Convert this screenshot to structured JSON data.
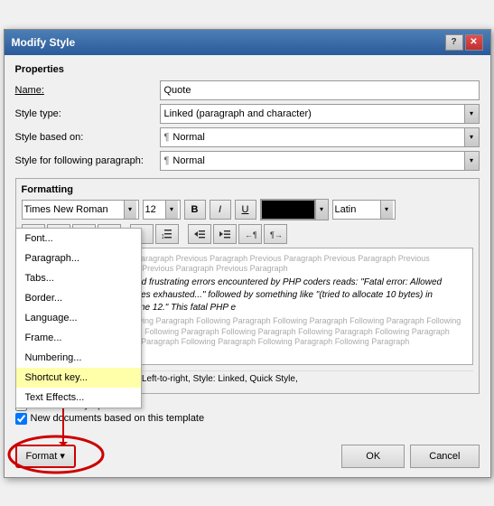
{
  "dialog": {
    "title": "Modify Style",
    "title_buttons": {
      "help": "?",
      "close": "✕"
    }
  },
  "properties": {
    "label": "Properties",
    "name_label": "Name:",
    "name_value": "Quote",
    "style_type_label": "Style type:",
    "style_type_value": "Linked (paragraph and character)",
    "style_based_label": "Style based on:",
    "style_based_value": "Normal",
    "style_following_label": "Style for following paragraph:",
    "style_following_value": "Normal"
  },
  "formatting": {
    "label": "Formatting",
    "font_name": "Times New Roman",
    "font_size": "12",
    "bold_label": "B",
    "italic_label": "I",
    "underline_label": "U",
    "lang_label": "Latin",
    "align_buttons": [
      "left-align",
      "center-align",
      "right-align",
      "justify-align",
      "left2",
      "center2",
      "right2"
    ],
    "indent_buttons": [
      "indent-left",
      "indent-right",
      "outdent",
      "more-indent"
    ]
  },
  "preview": {
    "prev_para": "Previous Paragraph Previous Paragraph Previous Paragraph Previous Paragraph Previous Paragraph Previous Paragraph Previous Paragraph Previous Paragraph Previous Paragraph",
    "main_text": "One of the most common and frustrating errors encountered by PHP coders reads: \"Fatal error: Allowed memory size of 8388608 bytes exhausted...\" followed by something like \"(tried to allocate 10 bytes) in /home/www/file.module on line 12.\" This fatal PHP e",
    "next_para": "rror Following Paragraph Following Paragraph Following Paragraph Following Paragraph Following Paragraph Following Paragraph Following Paragraph Following Paragraph Following Paragraph Following Paragraph Following Paragraph Following Paragraph Following Paragraph Following Paragraph Following Paragraph Following Paragraph"
  },
  "style_desc": "1, Complex Script Font: Italic, Left-to-right, Style: Linked, Quick Style,",
  "checkboxes": {
    "auto_update_label": "Automatically update",
    "new_docs_label": "New documents based on this template"
  },
  "footer": {
    "format_label": "Format ▾",
    "ok_label": "OK",
    "cancel_label": "Cancel"
  },
  "dropdown_menu": {
    "items": [
      {
        "label": "Font...",
        "name": "font-menu-item"
      },
      {
        "label": "Paragraph...",
        "name": "paragraph-menu-item"
      },
      {
        "label": "Tabs...",
        "name": "tabs-menu-item"
      },
      {
        "label": "Border...",
        "name": "border-menu-item"
      },
      {
        "label": "Language...",
        "name": "language-menu-item"
      },
      {
        "label": "Frame...",
        "name": "frame-menu-item"
      },
      {
        "label": "Numbering...",
        "name": "numbering-menu-item"
      },
      {
        "label": "Shortcut key...",
        "name": "shortcut-key-menu-item",
        "highlighted": true
      },
      {
        "label": "Text Effects...",
        "name": "text-effects-menu-item"
      }
    ]
  }
}
